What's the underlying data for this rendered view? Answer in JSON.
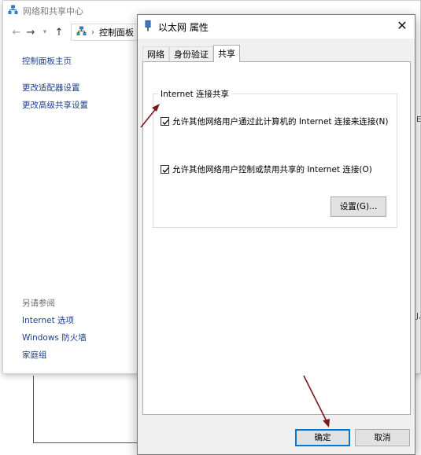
{
  "background_window": {
    "title": "网络和共享中心",
    "nav": {
      "back_icon": "back-arrow-icon",
      "forward_icon": "forward-arrow-icon",
      "recent_icon": "chevron-down-icon",
      "up_icon": "up-arrow-icon"
    },
    "breadcrumb": [
      "控制面板"
    ],
    "sidebar": {
      "home_label": "控制面板主页",
      "items": [
        "更改适配器设置",
        "更改高级共享设置"
      ]
    },
    "see_also": {
      "heading": "另请参阅",
      "items": [
        "Internet 选项",
        "Windows 防火墙",
        "家庭组"
      ]
    },
    "edge_chars": [
      "E",
      "J,"
    ]
  },
  "dialog": {
    "title": "以太网 属性",
    "close_glyph": "✕",
    "tabs": [
      "网络",
      "身份验证",
      "共享"
    ],
    "active_tab_index": 2,
    "group_title": "Internet 连接共享",
    "checkbox_1": {
      "label": "允许其他网络用户通过此计算机的 Internet 连接来连接(N)",
      "checked": true
    },
    "checkbox_2": {
      "label": "允许其他网络用户控制或禁用共享的 Internet 连接(O)",
      "checked": true
    },
    "settings_button": "设置(G)...",
    "ok_button": "确定",
    "cancel_button": "取消"
  },
  "colors": {
    "link": "#1c3f8b",
    "accent": "#0078d7",
    "annotation_arrow": "#7a1a1a"
  }
}
